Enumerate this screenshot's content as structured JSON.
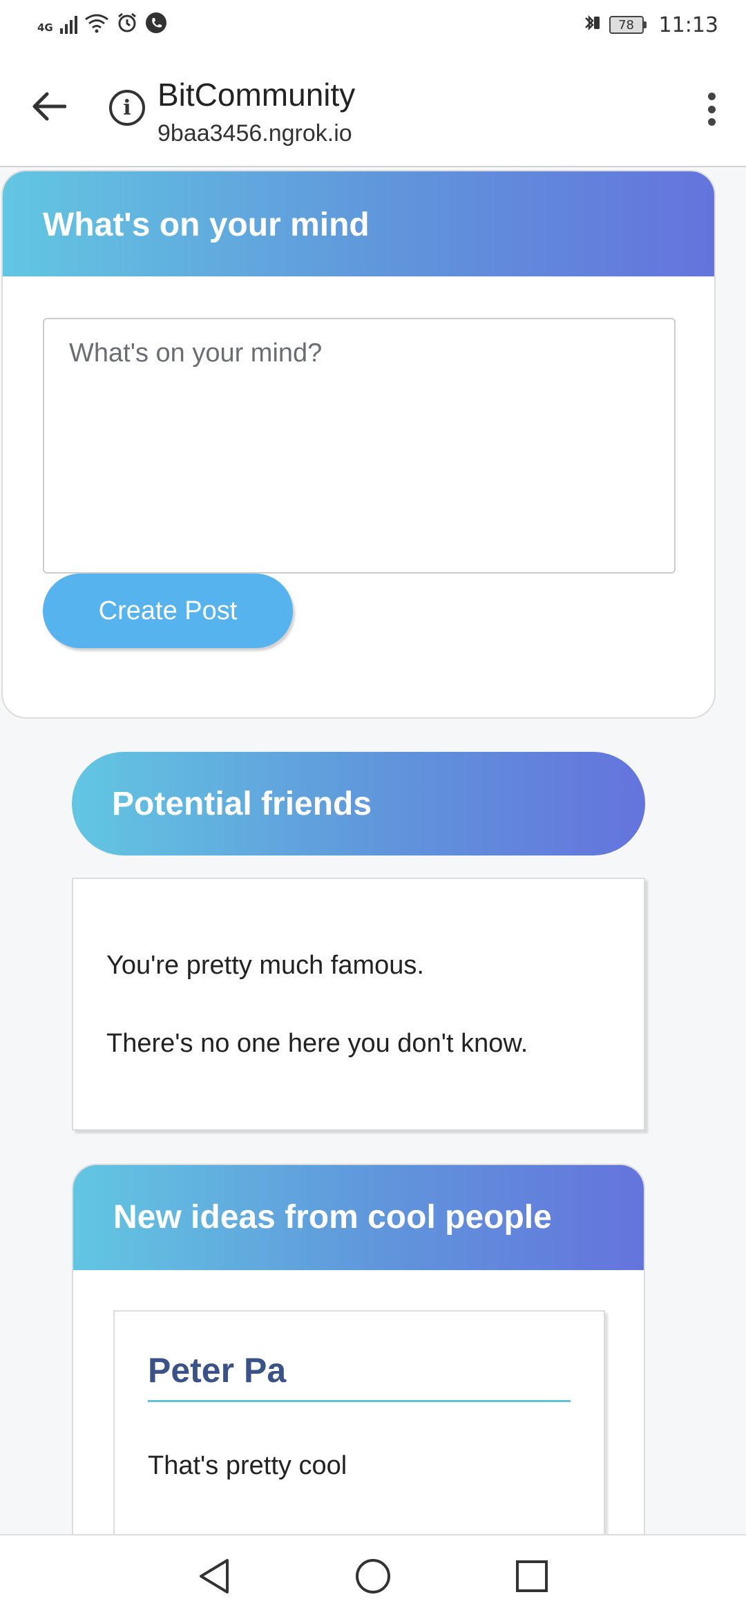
{
  "status_bar": {
    "network": "4G",
    "battery": "78",
    "time": "11:13"
  },
  "app_bar": {
    "title": "BitCommunity",
    "url": "9baa3456.ngrok.io"
  },
  "post_card": {
    "header": "What's on your mind",
    "placeholder": "What's on your mind?",
    "button_label": "Create Post"
  },
  "friends": {
    "header": "Potential friends",
    "line1": "You're pretty much famous.",
    "line2": "There's no one here you don't know."
  },
  "ideas": {
    "header": "New ideas from cool people",
    "posts": [
      {
        "author": "Peter Pa",
        "text": "That's pretty cool"
      }
    ]
  },
  "colors": {
    "gradient_start": "#62c6e2",
    "gradient_end": "#6474dd",
    "button": "#56b3ee",
    "author": "#3b5288",
    "author_underline": "#5fc2d8"
  }
}
